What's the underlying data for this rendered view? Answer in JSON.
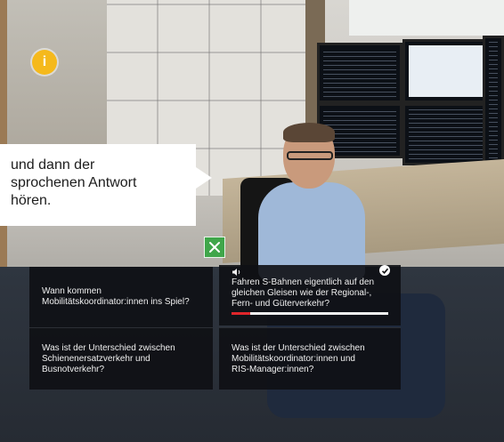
{
  "speech_bubble": {
    "lines": [
      "und dann der",
      "sprochenen Antwort",
      "hören."
    ]
  },
  "info_marker": {
    "label": "i",
    "color": "#f5b91c"
  },
  "close_button": {
    "color": "#3fa64a"
  },
  "questions": [
    {
      "lines": [
        "Wann kommen",
        "Mobilitätskoordinator:innen ins Spiel?"
      ]
    },
    {
      "lines": [
        "Fahren S-Bahnen eigentlich auf den",
        "gleichen Gleisen wie der Regional-,",
        "Fern- und Güterverkehr?"
      ],
      "active": true,
      "answered": true,
      "progress": 0.12
    },
    {
      "lines": [
        "Was ist der Unterschied zwischen",
        "Schienenersatzverkehr und",
        "Busnotverkehr?"
      ]
    },
    {
      "lines": [
        "Was ist der Unterschied zwischen",
        "Mobilitätskoordinator:innen und",
        "RIS-Manager:innen?"
      ]
    }
  ],
  "colors": {
    "accent_green": "#3fa64a",
    "progress_red": "#e0262b",
    "card_bg": "#0e1014"
  }
}
